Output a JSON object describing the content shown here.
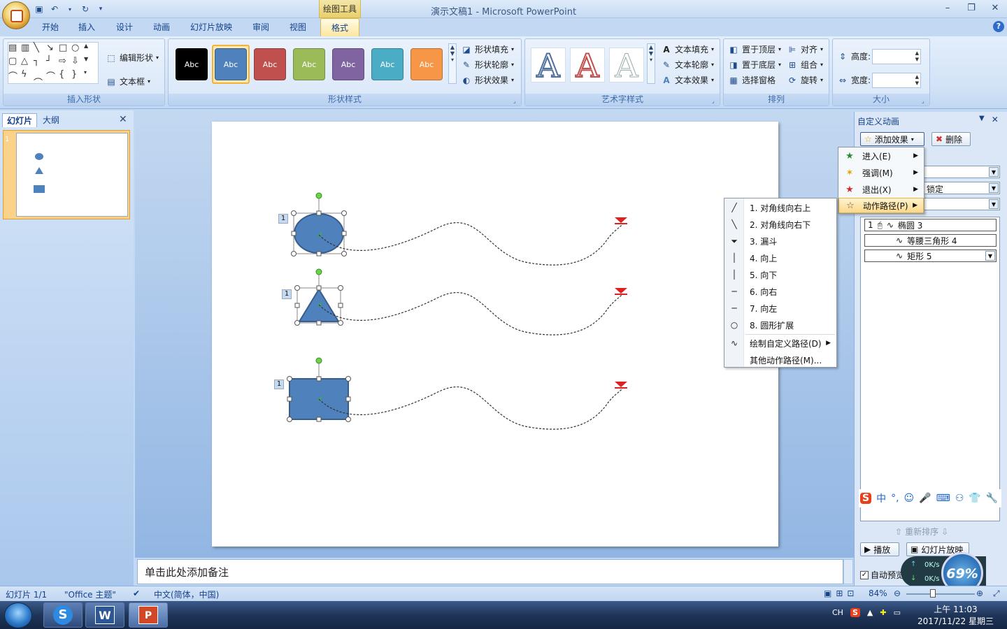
{
  "window": {
    "title": "演示文稿1 - Microsoft PowerPoint",
    "contextual_tab_group": "绘图工具"
  },
  "tabs": [
    "开始",
    "插入",
    "设计",
    "动画",
    "幻灯片放映",
    "审阅",
    "视图",
    "格式"
  ],
  "active_tab": "格式",
  "ribbon": {
    "insert_shapes": {
      "label": "插入形状",
      "edit_shape": "编辑形状",
      "text_box": "文本框"
    },
    "shape_styles": {
      "label": "形状样式",
      "presets": [
        {
          "text": "Abc",
          "color": "#000000"
        },
        {
          "text": "Abc",
          "color": "#4f81bd"
        },
        {
          "text": "Abc",
          "color": "#c0504d"
        },
        {
          "text": "Abc",
          "color": "#9bbb59"
        },
        {
          "text": "Abc",
          "color": "#8064a2"
        },
        {
          "text": "Abc",
          "color": "#4bacc6"
        },
        {
          "text": "Abc",
          "color": "#f79646"
        }
      ],
      "fill": "形状填充",
      "outline": "形状轮廓",
      "effects": "形状效果"
    },
    "wordart": {
      "label": "艺术字样式",
      "sample": "A",
      "fill": "文本填充",
      "outline": "文本轮廓",
      "effects": "文本效果"
    },
    "arrange": {
      "label": "排列",
      "bring_front": "置于顶层",
      "send_back": "置于底层",
      "selection_pane": "选择窗格",
      "align": "对齐",
      "group": "组合",
      "rotate": "旋转"
    },
    "size": {
      "label": "大小",
      "height": "高度:",
      "width": "宽度:"
    }
  },
  "left_pane": {
    "tabs": [
      "幻灯片",
      "大纲"
    ],
    "slide_number": "1"
  },
  "slide": {
    "tags": [
      "1",
      "1",
      "1"
    ]
  },
  "notes_placeholder": "单击此处添加备注",
  "task_pane": {
    "title": "自定义动画",
    "add_effect": "添加效果",
    "remove": "删除",
    "partial_field": "锁定",
    "effect_menu": [
      {
        "label": "进入(E)",
        "icon": "enter-icon"
      },
      {
        "label": "强调(M)",
        "icon": "emphasis-icon"
      },
      {
        "label": "退出(X)",
        "icon": "exit-icon"
      },
      {
        "label": "动作路径(P)",
        "icon": "motion-path-icon"
      }
    ],
    "path_menu": [
      {
        "label": "1. 对角线向右上",
        "icon": "╱"
      },
      {
        "label": "2. 对角线向右下",
        "icon": "╲"
      },
      {
        "label": "3. 漏斗",
        "icon": "▼"
      },
      {
        "label": "4. 向上",
        "icon": "│"
      },
      {
        "label": "5. 向下",
        "icon": "│"
      },
      {
        "label": "6. 向右",
        "icon": "─"
      },
      {
        "label": "7. 向左",
        "icon": "─"
      },
      {
        "label": "8. 圆形扩展",
        "icon": "○"
      }
    ],
    "path_menu_custom": "绘制自定义路径(D)",
    "path_menu_more": "其他动作路径(M)...",
    "animations": [
      {
        "order": "1",
        "name": "椭圆 3"
      },
      {
        "order": "",
        "name": "等腰三角形 4"
      },
      {
        "order": "",
        "name": "矩形 5"
      }
    ],
    "reorder": "重新排序",
    "play": "播放",
    "slideshow": "幻灯片放映",
    "autopreview": "自动预览"
  },
  "netmon": {
    "up": "0K/s",
    "down": "0K/s",
    "percent": "69%"
  },
  "status": {
    "slide": "幻灯片 1/1",
    "theme": "\"Office 主题\"",
    "language": "中文(简体，中国)",
    "zoom": "84%"
  },
  "taskbar": {
    "time": "上午 11:03",
    "date": "2017/11/22 星期三",
    "ime": "CH"
  }
}
